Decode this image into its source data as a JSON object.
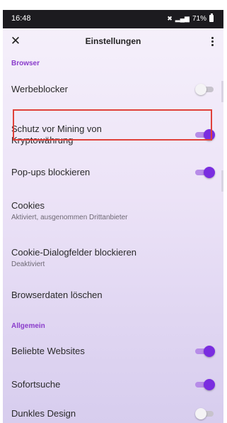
{
  "status_bar": {
    "time": "16:48",
    "battery_text": "71%",
    "icons": [
      "mute-icon",
      "signal-icon",
      "battery-icon"
    ]
  },
  "toolbar": {
    "close_glyph": "✕",
    "title": "Einstellungen",
    "menu_icon": "more-vert-icon"
  },
  "sections": {
    "browser": "Browser",
    "general": "Allgemein"
  },
  "settings": {
    "ad_blocker": {
      "title": "Werbeblocker",
      "enabled": false
    },
    "crypto_mining": {
      "title_line1": "Schutz vor Mining von",
      "title_line2": "Kryptowährung",
      "enabled": true
    },
    "popups": {
      "title": "Pop-ups blockieren",
      "enabled": true
    },
    "cookies": {
      "title": "Cookies",
      "subtitle": "Aktiviert, ausgenommen Drittanbieter"
    },
    "cookie_dialogs": {
      "title": "Cookie-Dialogfelder blockieren",
      "subtitle": "Deaktiviert"
    },
    "clear_data": {
      "title": "Browserdaten löschen"
    },
    "popular_sites": {
      "title": "Beliebte Websites",
      "enabled": true
    },
    "instant_search": {
      "title": "Sofortsuche",
      "enabled": true
    },
    "dark_mode": {
      "title": "Dunkles Design",
      "enabled": false
    }
  },
  "colors": {
    "accent": "#7a2de0",
    "section_header": "#8a3ccb",
    "highlight": "#e0413a"
  }
}
